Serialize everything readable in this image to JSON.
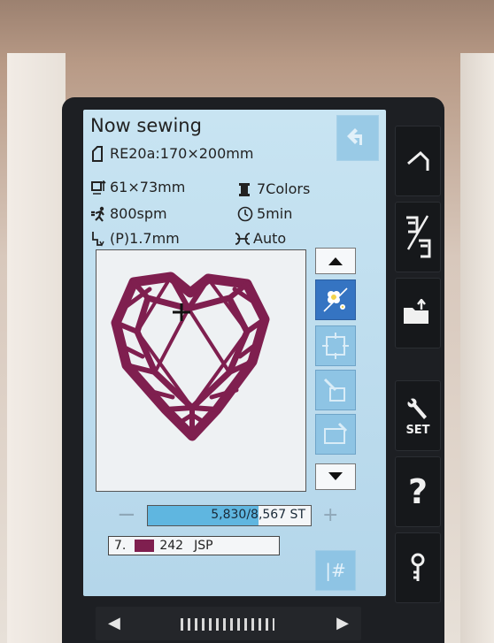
{
  "screen": {
    "title": "Now sewing",
    "design_name": "RE20a:170×200mm",
    "design_size": "61×73mm",
    "colors": "7Colors",
    "speed": "800spm",
    "time": "5min",
    "presser_height": "(P)1.7mm",
    "tension": "Auto"
  },
  "preview": {
    "design_color": "#7f1f4f"
  },
  "progress": {
    "minus_label": "−",
    "plus_label": "+",
    "text": "5,830/8,567 ST",
    "fraction": 0.68
  },
  "thread": {
    "index": "7.",
    "code": "242",
    "brand": "JSP",
    "color": "#7f1f4f"
  },
  "side_buttons": {
    "hash_label": "|#"
  },
  "right_panel": {
    "set_label": "SET",
    "help_label": "?"
  }
}
